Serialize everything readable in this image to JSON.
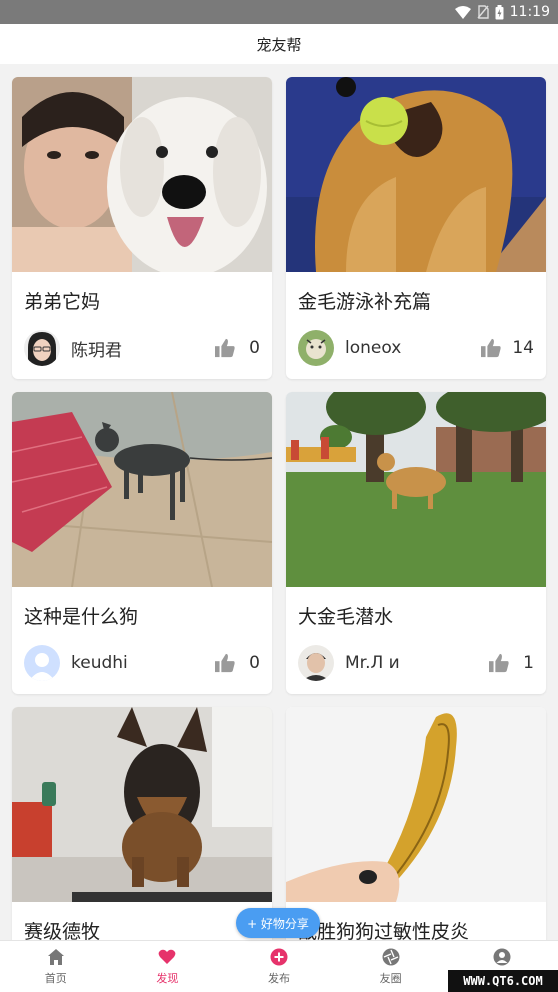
{
  "status_bar": {
    "time": "11:19"
  },
  "header": {
    "title": "宠友帮"
  },
  "posts": [
    {
      "title": "弟弟它妈",
      "user": "陈玥君",
      "likes": "0"
    },
    {
      "title": "金毛游泳补充篇",
      "user": "loneox",
      "likes": "14"
    },
    {
      "title": "这种是什么狗",
      "user": "keudhi",
      "likes": "0"
    },
    {
      "title": "大金毛潜水",
      "user": "Mr.Л и",
      "likes": "1"
    },
    {
      "title": "赛级德牧",
      "user": "",
      "likes": ""
    },
    {
      "title": "战胜狗狗过敏性皮炎",
      "user": "",
      "likes": ""
    }
  ],
  "share_button": {
    "label": "+ 好物分享"
  },
  "nav": {
    "items": [
      {
        "label": "首页",
        "icon": "home-icon"
      },
      {
        "label": "发现",
        "icon": "heart-icon",
        "active": true
      },
      {
        "label": "发布",
        "icon": "plus-circle-icon"
      },
      {
        "label": "友圈",
        "icon": "aperture-icon"
      },
      {
        "label": "我的",
        "icon": "user-icon"
      }
    ]
  },
  "watermark": "WWW.QT6.COM",
  "colors": {
    "accent": "#e6336b",
    "share": "#4a9df2",
    "status_bar": "#7a7a7a"
  }
}
